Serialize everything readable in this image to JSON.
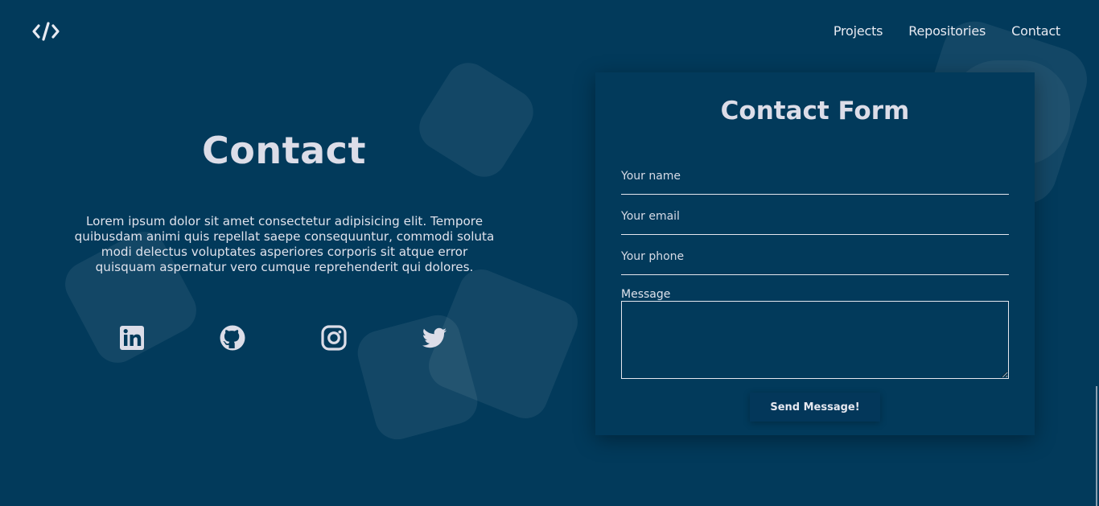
{
  "header": {
    "logo_icon": "code-icon",
    "nav": [
      {
        "label": "Projects"
      },
      {
        "label": "Repositories"
      },
      {
        "label": "Contact"
      }
    ]
  },
  "intro": {
    "title": "Contact",
    "text": "Lorem ipsum dolor sit amet consectetur adipisicing elit. Tempore quibusdam animi quis repellat saepe consequuntur, commodi soluta modi delectus voluptates asperiores corporis sit atque error quisquam aspernatur vero cumque reprehenderit qui dolores.",
    "social_icons": [
      "linkedin-icon",
      "github-icon",
      "instagram-icon",
      "twitter-icon"
    ]
  },
  "form": {
    "title": "Contact Form",
    "name_placeholder": "Your name",
    "email_placeholder": "Your email",
    "phone_placeholder": "Your phone",
    "message_label": "Message",
    "submit_label": "Send Message!"
  },
  "colors": {
    "background": "#023a5b",
    "text": "#dcdde8"
  }
}
